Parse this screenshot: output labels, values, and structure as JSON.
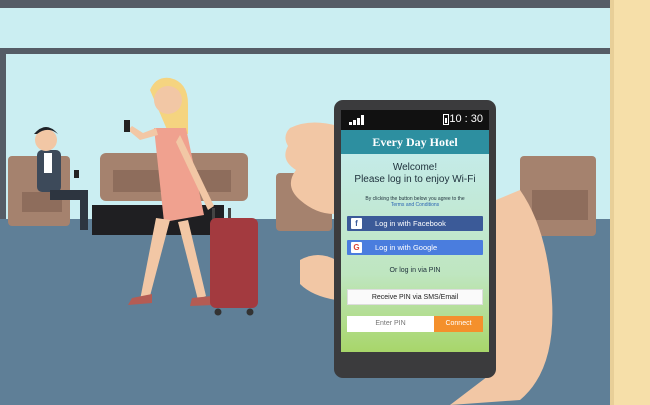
{
  "status_bar": {
    "time": "10 : 30",
    "signal_icon": "signal-bars-icon",
    "battery_icon": "battery-icon"
  },
  "app": {
    "title": "Every Day Hotel",
    "welcome_line1": "Welcome!",
    "welcome_line2": "Please log in to enjoy Wi-Fi",
    "terms_text": "By clicking the button below you agree to the",
    "terms_link": "Terms and Conditions",
    "facebook_button": "Log in with Facebook",
    "facebook_icon_glyph": "f",
    "google_button": "Log in with Google",
    "google_icon_glyph": "G",
    "or_text": "Or log in via PIN",
    "receive_pin_button": "Receive PIN via SMS/Email",
    "pin_placeholder": "Enter PIN",
    "connect_button": "Connect"
  },
  "colors": {
    "header": "#2d8fa0",
    "screen_gradient_top": "#c5ecf0",
    "screen_gradient_bottom": "#a8d66a",
    "facebook": "#3b5a98",
    "google": "#4a7dde",
    "connect": "#f4902c"
  }
}
